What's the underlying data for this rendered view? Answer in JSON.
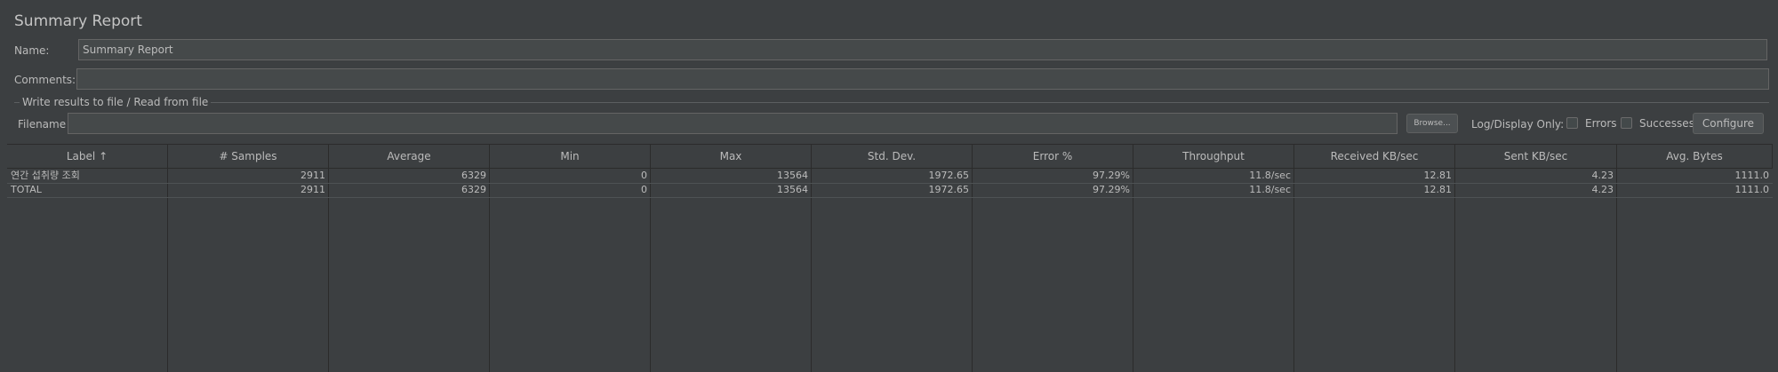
{
  "panel": {
    "title": "Summary Report",
    "name_label": "Name:",
    "name_value": "Summary Report",
    "comments_label": "Comments:",
    "comments_value": ""
  },
  "file_group": {
    "title": "Write results to file / Read from file",
    "filename_label": "Filename",
    "filename_value": "",
    "browse_label": "Browse...",
    "log_display_label": "Log/Display Only:",
    "errors_label": "Errors",
    "errors_checked": false,
    "successes_label": "Successes",
    "successes_checked": false,
    "configure_label": "Configure"
  },
  "table": {
    "columns": [
      "Label ↑",
      "# Samples",
      "Average",
      "Min",
      "Max",
      "Std. Dev.",
      "Error %",
      "Throughput",
      "Received KB/sec",
      "Sent KB/sec",
      "Avg. Bytes"
    ],
    "rows": [
      [
        "연간 섭취량 조회",
        "2911",
        "6329",
        "0",
        "13564",
        "1972.65",
        "97.29%",
        "11.8/sec",
        "12.81",
        "4.23",
        "1111.0"
      ],
      [
        "TOTAL",
        "2911",
        "6329",
        "0",
        "13564",
        "1972.65",
        "97.29%",
        "11.8/sec",
        "12.81",
        "4.23",
        "1111.0"
      ]
    ]
  }
}
